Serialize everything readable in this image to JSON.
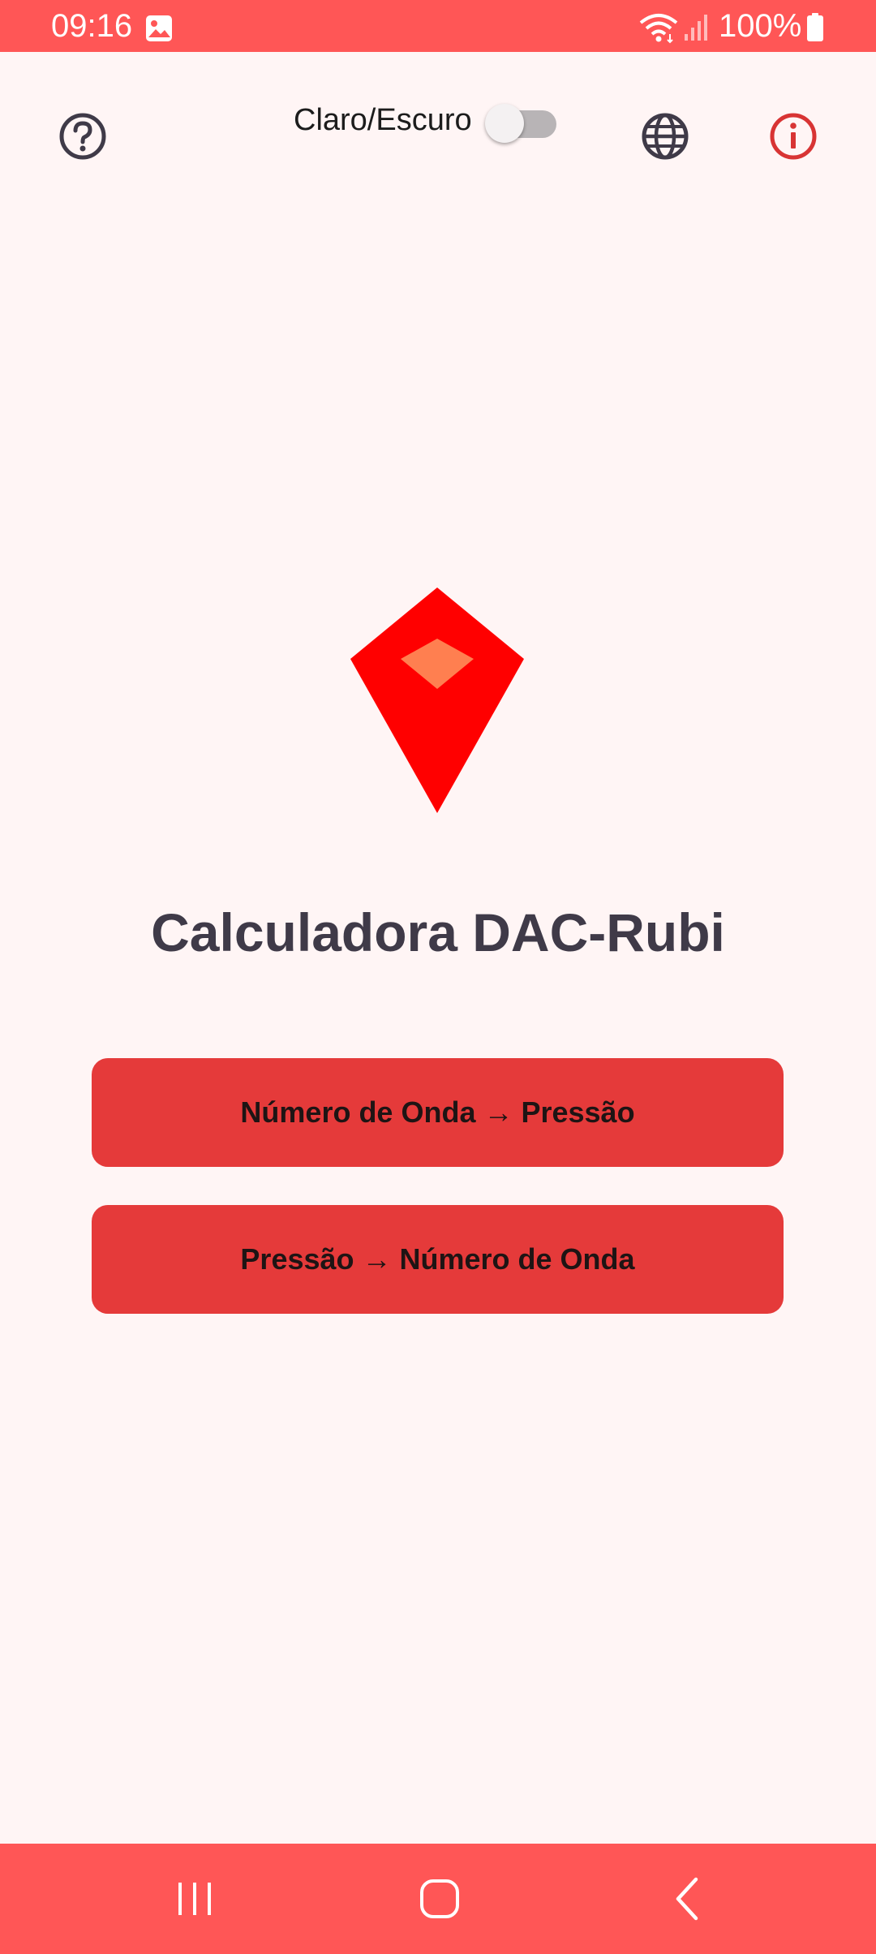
{
  "status_bar": {
    "time": "09:16",
    "battery": "100%",
    "icons": [
      "gallery-icon",
      "wifi-icon",
      "signal-icon",
      "battery-icon"
    ]
  },
  "top_bar": {
    "help_icon": "help-circle-icon",
    "theme_toggle_label": "Claro/Escuro",
    "theme_toggle_on": false,
    "language_icon": "globe-icon",
    "info_icon": "info-circle-icon"
  },
  "main": {
    "logo": "ruby-gem-logo",
    "title": "Calculadora DAC-Rubi",
    "buttons": [
      {
        "label": "Número de Onda → Pressão"
      },
      {
        "label": "Pressão → Número de Onda"
      }
    ]
  },
  "nav_bar": {
    "icons": [
      "recents-icon",
      "home-icon",
      "back-icon"
    ]
  },
  "colors": {
    "status_bar": "#ff5656",
    "background": "#fff5f5",
    "button": "#e53a3a",
    "title_text": "#3f3a48",
    "info_icon": "#d83434",
    "logo_red": "#ff0000",
    "logo_facet": "#ff7f50"
  }
}
